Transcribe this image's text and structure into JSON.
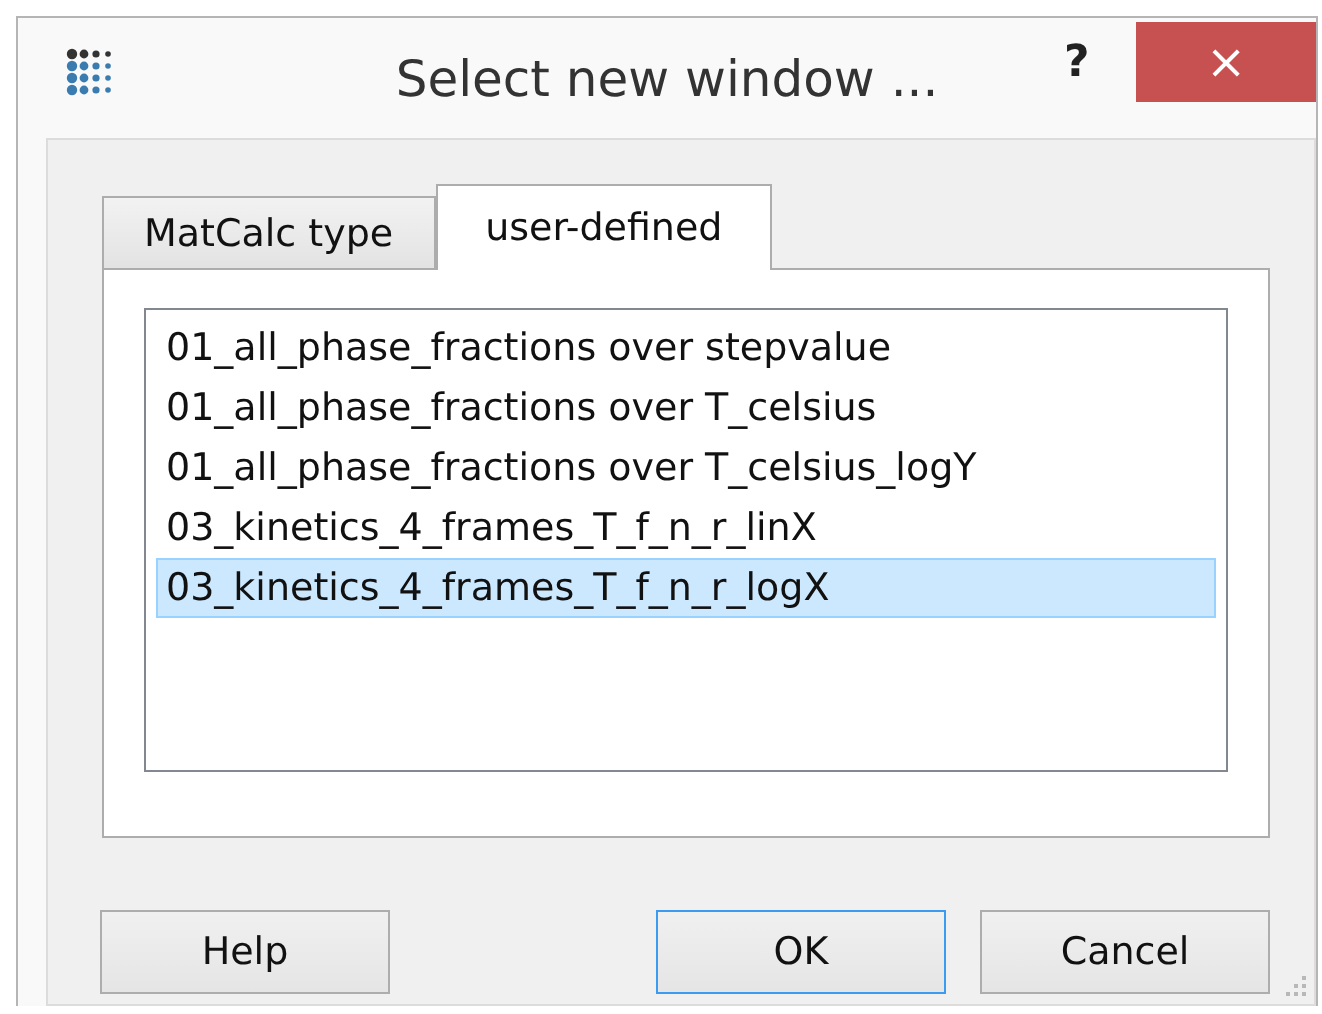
{
  "window": {
    "title": "Select new window ...",
    "help": "?",
    "close": "×"
  },
  "tabs": [
    {
      "label": "MatCalc type",
      "selected": false
    },
    {
      "label": "user-defined",
      "selected": true
    }
  ],
  "list": {
    "items": [
      {
        "label": "01_all_phase_fractions over stepvalue",
        "selected": false
      },
      {
        "label": "01_all_phase_fractions over T_celsius",
        "selected": false
      },
      {
        "label": "01_all_phase_fractions over T_celsius_logY",
        "selected": false
      },
      {
        "label": "03_kinetics_4_frames_T_f_n_r_linX",
        "selected": false
      },
      {
        "label": "03_kinetics_4_frames_T_f_n_r_logX",
        "selected": true
      }
    ]
  },
  "buttons": [
    {
      "label": "Help",
      "focused": false
    },
    {
      "label": "OK",
      "focused": true
    },
    {
      "label": "Cancel",
      "focused": false
    }
  ]
}
